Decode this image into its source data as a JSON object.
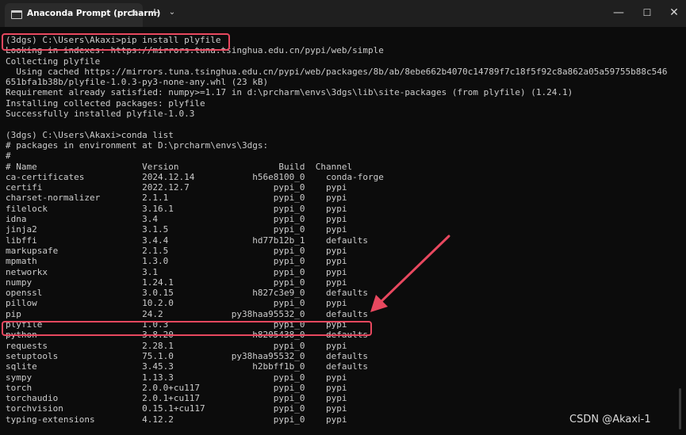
{
  "window": {
    "tab_title": "Anaconda Prompt (prcharm)",
    "tab_close_icon": "✕",
    "new_tab_icon": "+",
    "dropdown_icon": "⌄",
    "minimize_icon": "—",
    "maximize_icon": "☐",
    "close_icon": "✕"
  },
  "terminal": {
    "lines": [
      "(3dgs) C:\\Users\\Akaxi>pip install plyfile",
      "Looking in indexes: https://mirrors.tuna.tsinghua.edu.cn/pypi/web/simple",
      "Collecting plyfile",
      "  Using cached https://mirrors.tuna.tsinghua.edu.cn/pypi/web/packages/8b/ab/8ebe662b4070c14789f7c18f5f92c8a862a05a59755b88c546",
      "651bfa1b38b/plyfile-1.0.3-py3-none-any.whl (23 kB)",
      "Requirement already satisfied: numpy>=1.17 in d:\\prcharm\\envs\\3dgs\\lib\\site-packages (from plyfile) (1.24.1)",
      "Installing collected packages: plyfile",
      "Successfully installed plyfile-1.0.3",
      "",
      "(3dgs) C:\\Users\\Akaxi>conda list",
      "# packages in environment at D:\\prcharm\\envs\\3dgs:",
      "#",
      "# Name                    Version                   Build  Channel",
      "ca-certificates           2024.12.14           h56e8100_0    conda-forge",
      "certifi                   2022.12.7                pypi_0    pypi",
      "charset-normalizer        2.1.1                    pypi_0    pypi",
      "filelock                  3.16.1                   pypi_0    pypi",
      "idna                      3.4                      pypi_0    pypi",
      "jinja2                    3.1.5                    pypi_0    pypi",
      "libffi                    3.4.4                hd77b12b_1    defaults",
      "markupsafe                2.1.5                    pypi_0    pypi",
      "mpmath                    1.3.0                    pypi_0    pypi",
      "networkx                  3.1                      pypi_0    pypi",
      "numpy                     1.24.1                   pypi_0    pypi",
      "openssl                   3.0.15               h827c3e9_0    defaults",
      "pillow                    10.2.0                   pypi_0    pypi",
      "pip                       24.2             py38haa95532_0    defaults",
      "plyfile                   1.0.3                    pypi_0    pypi",
      "python                    3.8.20               h8205438_0    defaults",
      "requests                  2.28.1                   pypi_0    pypi",
      "setuptools                75.1.0           py38haa95532_0    defaults",
      "sqlite                    3.45.3               h2bbff1b_0    defaults",
      "sympy                     1.13.3                   pypi_0    pypi",
      "torch                     2.0.0+cu117              pypi_0    pypi",
      "torchaudio                2.0.1+cu117              pypi_0    pypi",
      "torchvision               0.15.1+cu117             pypi_0    pypi",
      "typing-extensions         4.12.2                   pypi_0    pypi"
    ]
  },
  "watermark": "CSDN @Akaxi-1",
  "colors": {
    "highlight": "#e8485f",
    "text": "#cccccc",
    "background": "#0c0c0c"
  }
}
